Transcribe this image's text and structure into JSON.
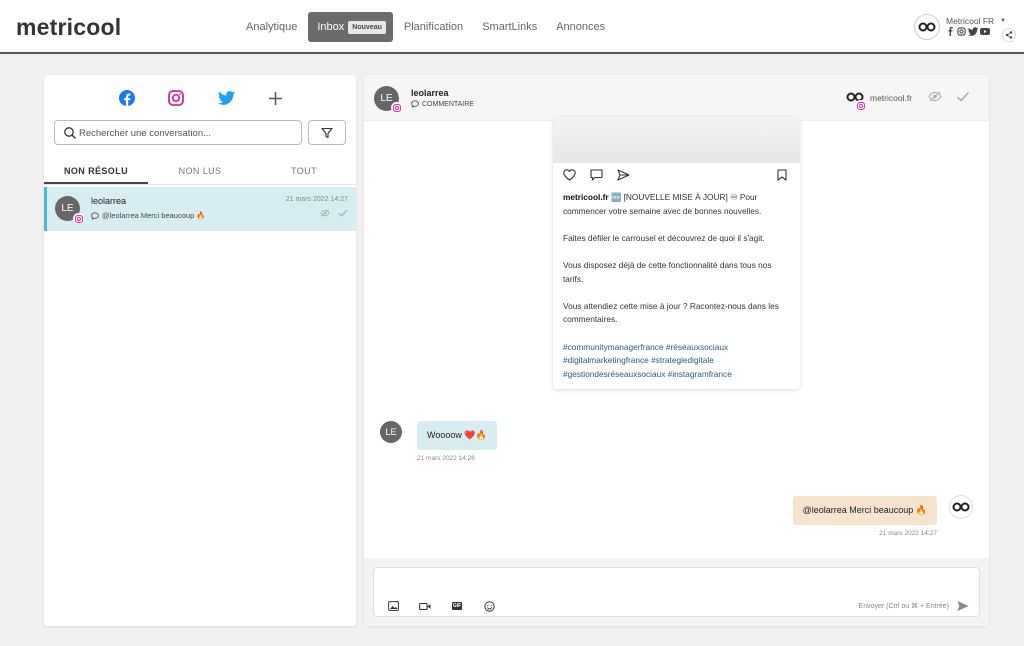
{
  "app": {
    "logo": "metricool",
    "nav": [
      {
        "label": "Analytique"
      },
      {
        "label": "Inbox",
        "badge": "Nouveau",
        "active": true
      },
      {
        "label": "Planification"
      },
      {
        "label": "SmartLinks"
      },
      {
        "label": "Annonces"
      }
    ],
    "account": {
      "name": "Metricool FR"
    }
  },
  "sidebar": {
    "networks": [
      "facebook-icon",
      "instagram-icon",
      "twitter-icon",
      "plus-icon"
    ],
    "search_placeholder": "Rechercher une conversation...",
    "tabs": [
      "NON RÉSOLU",
      "NON LUS",
      "TOUT"
    ],
    "conversations": [
      {
        "initials": "LE",
        "name": "leolarrea",
        "date": "21 mars 2022 14:27",
        "preview": "@leolarrea Merci beaucoup 🔥"
      }
    ]
  },
  "thread": {
    "initials": "LE",
    "name": "leolarrea",
    "type": "COMMENTAIRE",
    "account_name": "metricool.fr",
    "post": {
      "author": "metricool.fr",
      "lines": [
        "🆕 [NOUVELLE MISE À JOUR] ♾ Pour commencer votre semaine avec de bonnes nouvelles.",
        "Faites défiler le carrousel et découvrez de quoi il s'agit.",
        "Vous disposez déjà de cette fonctionnalité dans tous nos tarifs.",
        "Vous attendiez cette mise à jour ? Racontez-nous dans les commentaires."
      ],
      "hashtags": "#communitymanagerfrance #réseauxsociaux #digitalmarketingfrance #strategiedigitale #gestiondesréseauxsociaux #instagramfrance"
    },
    "incoming": {
      "initials": "LE",
      "text": "Woooow ❤️🔥",
      "date": "21 mars 2022 14:26"
    },
    "outgoing": {
      "text": "@leolarrea Merci beaucoup 🔥",
      "date": "21 mars 2022 14:27"
    },
    "composer": {
      "hint": "Envoyer (Ctrl ou ⌘ + Entrée)",
      "gif": "GIF"
    }
  },
  "colors": {
    "facebook": "#1877f2",
    "instagram": "#d6249f",
    "twitter": "#1da1f2",
    "selected_row": "#d7edf2",
    "outgoing_bubble": "#f8e3cc"
  }
}
